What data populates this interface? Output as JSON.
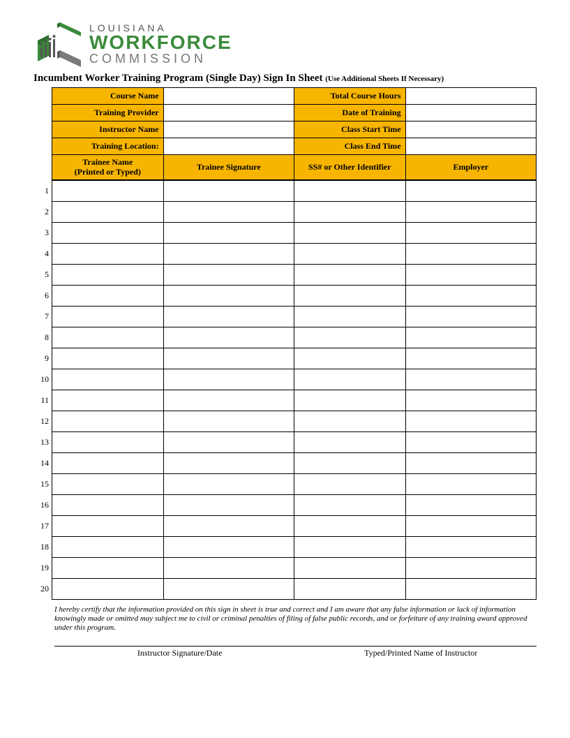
{
  "logo": {
    "line1": "LOUISIANA",
    "line2": "WORKFORCE",
    "line3": "COMMISSION"
  },
  "title": "Incumbent Worker Training Program (Single Day) Sign In Sheet",
  "title_note": "(Use Additional Sheets If Necessary)",
  "info": {
    "left": [
      {
        "label": "Course Name",
        "value": ""
      },
      {
        "label": "Training Provider",
        "value": ""
      },
      {
        "label": "Instructor Name",
        "value": ""
      },
      {
        "label": "Training Location:",
        "value": ""
      }
    ],
    "right": [
      {
        "label": "Total Course Hours",
        "value": ""
      },
      {
        "label": "Date of Training",
        "value": ""
      },
      {
        "label": "Class Start Time",
        "value": ""
      },
      {
        "label": "Class End Time",
        "value": ""
      }
    ]
  },
  "columns": {
    "c1a": "Trainee Name",
    "c1b": "(Printed or Typed)",
    "c2": "Trainee Signature",
    "c3": "SS# or Other Identifier",
    "c4": "Employer"
  },
  "rows": [
    {
      "n": "1",
      "name": "",
      "sig": "",
      "ss": "",
      "emp": ""
    },
    {
      "n": "2",
      "name": "",
      "sig": "",
      "ss": "",
      "emp": ""
    },
    {
      "n": "3",
      "name": "",
      "sig": "",
      "ss": "",
      "emp": ""
    },
    {
      "n": "4",
      "name": "",
      "sig": "",
      "ss": "",
      "emp": ""
    },
    {
      "n": "5",
      "name": "",
      "sig": "",
      "ss": "",
      "emp": ""
    },
    {
      "n": "6",
      "name": "",
      "sig": "",
      "ss": "",
      "emp": ""
    },
    {
      "n": "7",
      "name": "",
      "sig": "",
      "ss": "",
      "emp": ""
    },
    {
      "n": "8",
      "name": "",
      "sig": "",
      "ss": "",
      "emp": ""
    },
    {
      "n": "9",
      "name": "",
      "sig": "",
      "ss": "",
      "emp": ""
    },
    {
      "n": "10",
      "name": "",
      "sig": "",
      "ss": "",
      "emp": ""
    },
    {
      "n": "11",
      "name": "",
      "sig": "",
      "ss": "",
      "emp": ""
    },
    {
      "n": "12",
      "name": "",
      "sig": "",
      "ss": "",
      "emp": ""
    },
    {
      "n": "13",
      "name": "",
      "sig": "",
      "ss": "",
      "emp": ""
    },
    {
      "n": "14",
      "name": "",
      "sig": "",
      "ss": "",
      "emp": ""
    },
    {
      "n": "15",
      "name": "",
      "sig": "",
      "ss": "",
      "emp": ""
    },
    {
      "n": "16",
      "name": "",
      "sig": "",
      "ss": "",
      "emp": ""
    },
    {
      "n": "17",
      "name": "",
      "sig": "",
      "ss": "",
      "emp": ""
    },
    {
      "n": "18",
      "name": "",
      "sig": "",
      "ss": "",
      "emp": ""
    },
    {
      "n": "19",
      "name": "",
      "sig": "",
      "ss": "",
      "emp": ""
    },
    {
      "n": "20",
      "name": "",
      "sig": "",
      "ss": "",
      "emp": ""
    }
  ],
  "certification": "I hereby certify that the information provided on this sign in sheet is true and correct and I am aware that any false information or lack of information knowingly made or omitted may subject me to civil or criminal penalties of filing of false public records, and or forfeiture of any training award approved under this program.",
  "sig": {
    "left": "Instructor Signature/Date",
    "right": "Typed/Printed Name of Instructor"
  }
}
